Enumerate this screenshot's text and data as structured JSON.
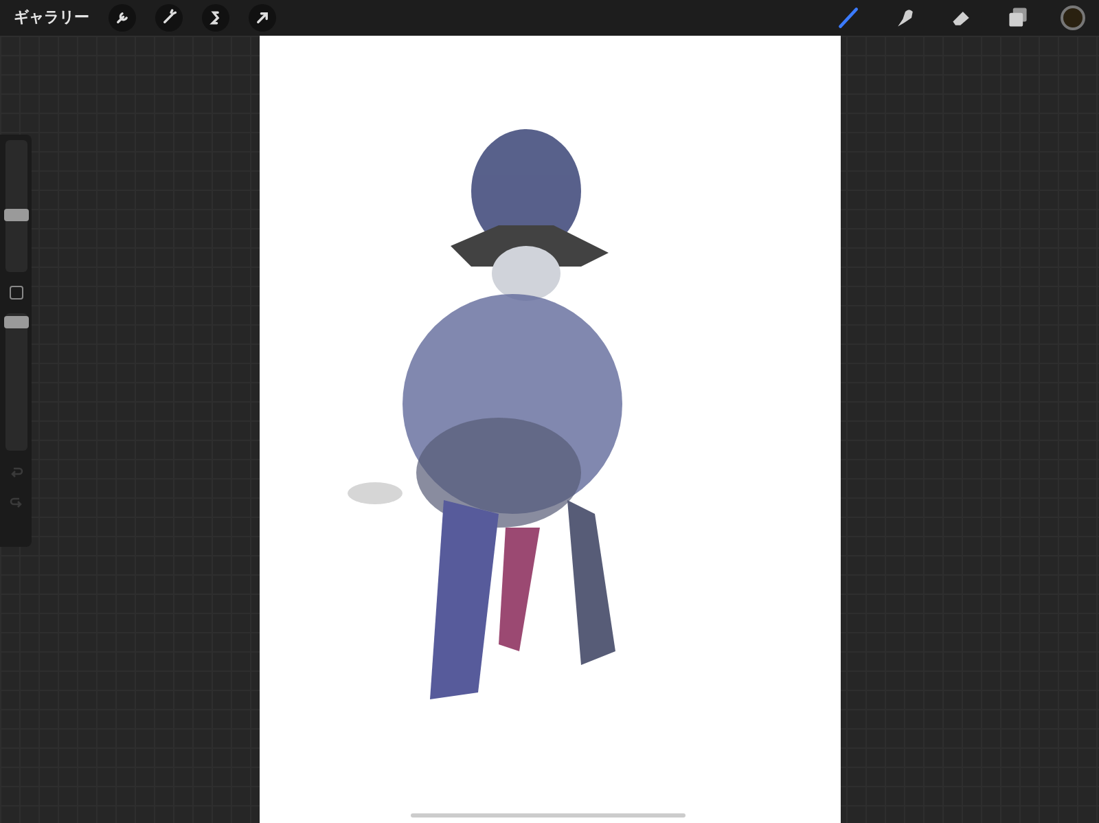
{
  "toolbar": {
    "gallery": "ギャラリー",
    "actions": [
      {
        "kind": "wrench"
      },
      {
        "kind": "wand"
      },
      {
        "kind": "selection"
      },
      {
        "kind": "transform"
      }
    ],
    "tools": [
      {
        "kind": "brush",
        "selected": true
      },
      {
        "kind": "smudge",
        "selected": false
      },
      {
        "kind": "eraser",
        "selected": false
      },
      {
        "kind": "layers",
        "selected": false
      }
    ],
    "color": "#2a2110"
  },
  "sidebar": {
    "size": {
      "level": 0.43
    },
    "opacity": {
      "level": 0.93
    },
    "undo": {
      "disabled": true
    },
    "redo": {
      "disabled": true
    }
  }
}
